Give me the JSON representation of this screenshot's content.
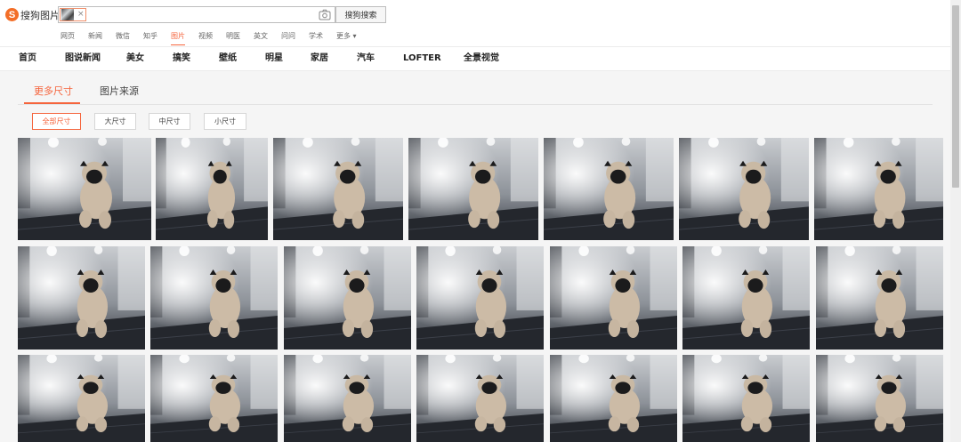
{
  "logo": {
    "mark": "S",
    "text": "搜狗图片"
  },
  "search": {
    "chip_close": "×",
    "button_label": "搜狗搜索"
  },
  "categories": [
    {
      "label": "网页"
    },
    {
      "label": "新闻"
    },
    {
      "label": "微信"
    },
    {
      "label": "知乎"
    },
    {
      "label": "图片"
    },
    {
      "label": "视频"
    },
    {
      "label": "明医"
    },
    {
      "label": "英文"
    },
    {
      "label": "问问"
    },
    {
      "label": "学术"
    },
    {
      "label": "更多 ▾"
    }
  ],
  "active_category": "图片",
  "channels": [
    {
      "label": "首页"
    },
    {
      "label": "图说新闻"
    },
    {
      "label": "美女"
    },
    {
      "label": "搞笑"
    },
    {
      "label": "壁纸"
    },
    {
      "label": "明星"
    },
    {
      "label": "家居"
    },
    {
      "label": "汽车"
    },
    {
      "label": "LOFTER"
    },
    {
      "label": "全景视觉"
    }
  ],
  "tabs": {
    "more_sizes": "更多尺寸",
    "image_source": "图片来源"
  },
  "size_filters": [
    {
      "label": "全部尺寸"
    },
    {
      "label": "大尺寸"
    },
    {
      "label": "中尺寸"
    },
    {
      "label": "小尺寸"
    }
  ],
  "active_size": "全部尺寸",
  "colors": {
    "accent": "#f5643c",
    "logo": "#f36e27"
  }
}
